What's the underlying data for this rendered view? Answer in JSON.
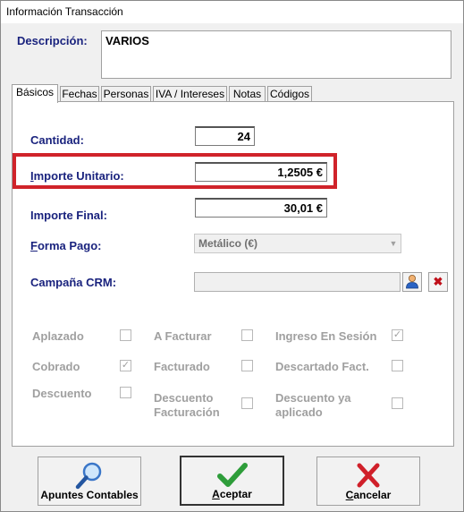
{
  "window": {
    "title": "Información Transacción"
  },
  "descripcion": {
    "label": "Descripción:",
    "value": "VARIOS"
  },
  "tabs": [
    "Básicos",
    "Fechas",
    "Personas",
    "IVA / Intereses",
    "Notas",
    "Códigos"
  ],
  "fields": {
    "cantidad": {
      "label": "Cantidad:",
      "value": "24"
    },
    "importe_unitario": {
      "label_u": "I",
      "label_rest": "mporte Unitario:",
      "value": "1,2505 €"
    },
    "importe_final": {
      "label": "Importe Final:",
      "value": "30,01 €"
    },
    "forma_pago": {
      "label_u": "F",
      "label_rest": "orma Pago:",
      "value": "Metálico (€)"
    },
    "campana_crm": {
      "label": "Campaña CRM:"
    }
  },
  "checkboxes": [
    {
      "label": "Aplazado",
      "checked": false
    },
    {
      "label": "A Facturar",
      "checked": false
    },
    {
      "label": "Ingreso En Sesión",
      "checked": true
    },
    {
      "label": "Cobrado",
      "checked": true
    },
    {
      "label": "Facturado",
      "checked": false
    },
    {
      "label": "Descartado Fact.",
      "checked": false
    },
    {
      "label": "Descuento",
      "checked": false
    },
    {
      "label_line1": "Descuento",
      "label_line2": "Facturación",
      "checked": false
    },
    {
      "label_line1": "Descuento ya",
      "label_line2": "aplicado",
      "checked": false
    }
  ],
  "buttons": {
    "apuntes": {
      "label": "Apuntes Contables"
    },
    "aceptar": {
      "label_u": "A",
      "label_rest": "ceptar"
    },
    "cancelar": {
      "label_u": "C",
      "label_rest": "ancelar"
    }
  },
  "colors": {
    "label": "#1a237e",
    "highlight": "#d0232a",
    "disabled": "#a0a0a0"
  }
}
